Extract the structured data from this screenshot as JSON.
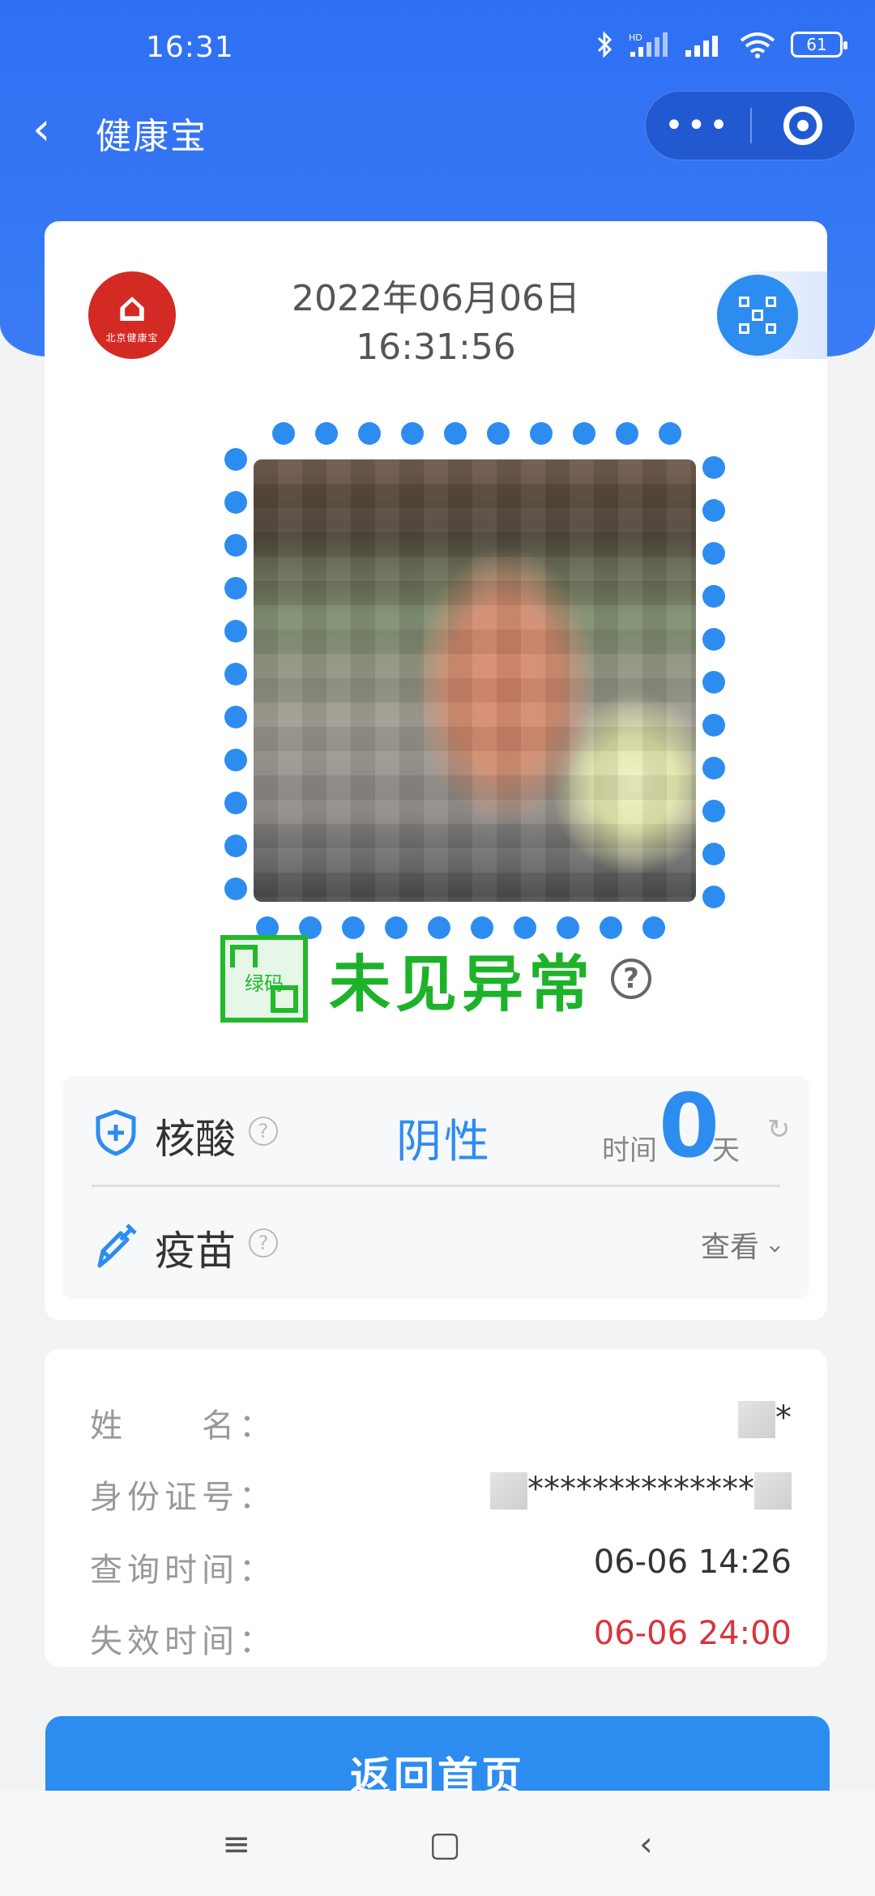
{
  "status_bar": {
    "time": "16:31",
    "battery": "61",
    "icons": [
      "bluetooth-icon",
      "hd-signal-icon",
      "signal-icon",
      "wifi-icon",
      "battery-icon"
    ]
  },
  "nav": {
    "back_icon": "‹",
    "title": "健康宝",
    "more_icon": "•••"
  },
  "card": {
    "logo_text": "北京健康宝",
    "date": "2022年06月06日",
    "time": "16:31:56",
    "code_label": "绿码",
    "status": "未见异常",
    "help": "?"
  },
  "tests": {
    "nucleic": {
      "label": "核酸",
      "help": "?",
      "result": "阴性",
      "time_label": "时间",
      "days": "0",
      "day_unit": "天",
      "refresh": "↻"
    },
    "vaccine": {
      "label": "疫苗",
      "help": "?",
      "view": "查看",
      "chevron": "›"
    }
  },
  "info": {
    "name": {
      "key": "姓　　名：",
      "value_suffix": "*"
    },
    "id": {
      "key": "身份证号：",
      "value_mid": "**************"
    },
    "query": {
      "key": "查询时间：",
      "value": "06-06 14:26"
    },
    "expire": {
      "key": "失效时间：",
      "value": "06-06 24:00"
    }
  },
  "home_button": "返回首页",
  "colors": {
    "brand_blue": "#2d8cf0",
    "green": "#1db22a",
    "expire_red": "#d9343d"
  },
  "sys_nav": {
    "menu": "≡",
    "home": "▢",
    "back": "‹"
  }
}
